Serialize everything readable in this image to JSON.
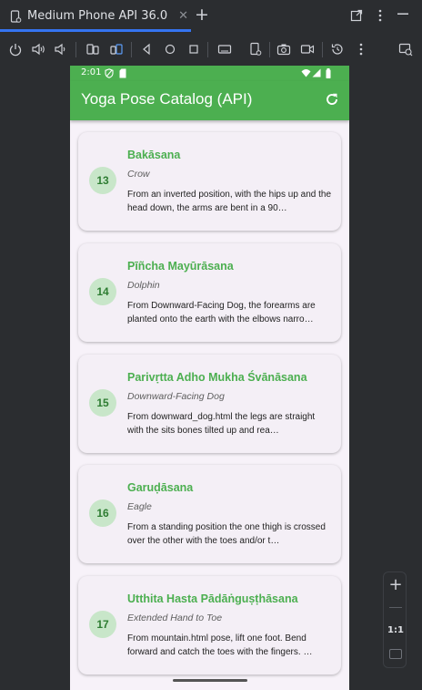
{
  "ide": {
    "tab_title": "Medium Phone API 36.0",
    "tab_close": "✕",
    "tab_add": "+"
  },
  "phone": {
    "status_time": "2:01",
    "app_title": "Yoga Pose Catalog (API)",
    "poses": [
      {
        "number": "13",
        "sanskrit": "Bakāsana",
        "english": "Crow",
        "description": "From an inverted position, with the hips up and the head down, the arms are bent in a 90…"
      },
      {
        "number": "14",
        "sanskrit": "Pīñcha Mayūrāsana",
        "english": "Dolphin",
        "description": "From Downward-Facing Dog, the forearms are planted onto the earth with the elbows narro…"
      },
      {
        "number": "15",
        "sanskrit": "Parivṛtta Adho Mukha Śvānāsana",
        "english": "Downward-Facing Dog",
        "description": "From downward_dog.html the legs are straight with the sits bones tilted up and rea…"
      },
      {
        "number": "16",
        "sanskrit": "Garuḍāsana",
        "english": "Eagle",
        "description": "From a standing position the one thigh is crossed over the other with the toes and/or t…"
      },
      {
        "number": "17",
        "sanskrit": "Utthita Hasta Pādāṅguṣṭhāsana",
        "english": "Extended Hand to Toe",
        "description": "From mountain.html pose, lift one foot.  Bend forward and catch the toes with the fingers.  …"
      }
    ]
  },
  "zoom": {
    "plus": "+",
    "ratio": "1:1"
  },
  "colors": {
    "app_bar": "#4caf50",
    "pose_name": "#4caf50",
    "badge_bg": "#c8e6c9",
    "ide_bg": "#2b2d30",
    "tab_accent": "#3574f0"
  }
}
